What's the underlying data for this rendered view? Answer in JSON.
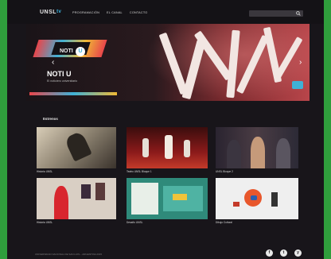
{
  "header": {
    "logo_text": "UNSL",
    "logo_mark": "tv",
    "nav": [
      "PROGRAMACIÓN",
      "EL CANAL",
      "CONTACTO"
    ],
    "search_icon": "magnifier-icon"
  },
  "hero": {
    "logo_text": "NOTI",
    "badge_text": "U",
    "title": "NOTI U",
    "subtitle": "El noticiero universitario",
    "prev_arrow": "‹",
    "next_arrow": "›"
  },
  "section": {
    "title": "Estrenos"
  },
  "cards": [
    {
      "caption": "Historia UNSL"
    },
    {
      "caption": "Teatro UNSL Bloque 1"
    },
    {
      "caption": "UNSL Bloque 2"
    },
    {
      "caption": "Historia UNSL"
    },
    {
      "caption": "Desafío UNSL"
    },
    {
      "caption": "Dibujo Cultural"
    }
  ],
  "footer": {
    "text": "UNIVERSIDAD NACIONAL DE SAN LUIS – ARGENTINA 2015",
    "social": [
      "f",
      "t",
      "y"
    ]
  }
}
